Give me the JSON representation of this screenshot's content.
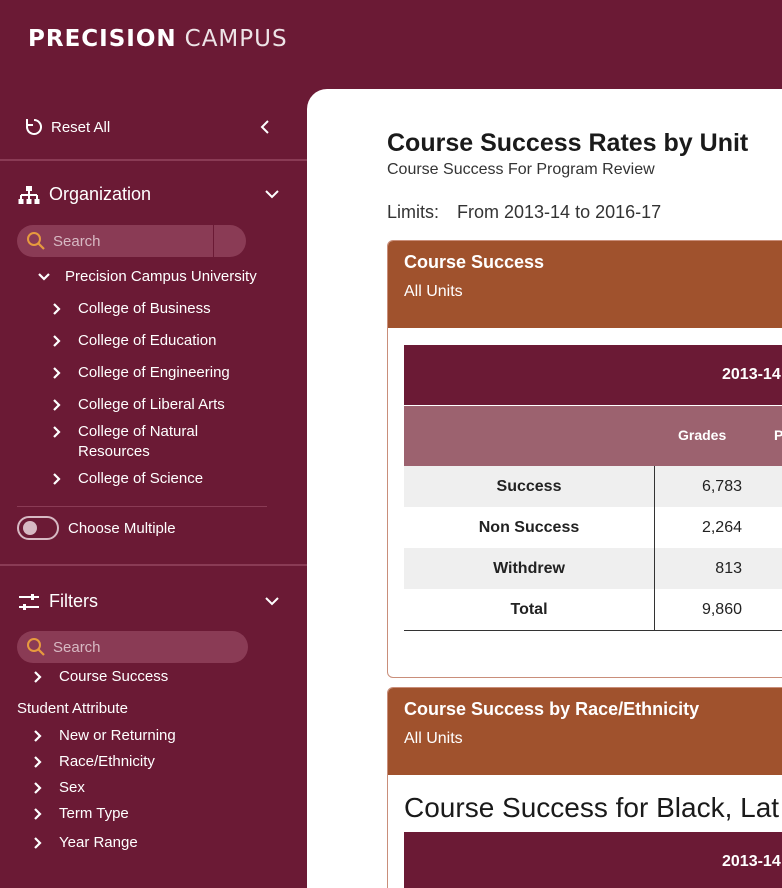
{
  "brand": {
    "bold": "PRECISION",
    "light": "CAMPUS"
  },
  "sidebar": {
    "reset_label": "Reset All",
    "organization": {
      "title": "Organization",
      "search_placeholder": "Search",
      "root": "Precision Campus University",
      "items": [
        "College of Business",
        "College of Education",
        "College of Engineering",
        "College of Liberal Arts",
        "College of Natural Resources",
        "College of Science"
      ],
      "choose_multiple": "Choose Multiple"
    },
    "filters": {
      "title": "Filters",
      "search_placeholder": "Search",
      "course_success": "Course Success",
      "group_label": "Student Attribute",
      "items": [
        "New or Returning",
        "Race/Ethnicity",
        "Sex",
        "Term Type",
        "Year Range"
      ]
    }
  },
  "main": {
    "title": "Course Success Rates by Unit",
    "subtitle": "Course Success For Program Review",
    "limits_label": "Limits:",
    "limits_value": "From 2013-14 to 2016-17",
    "panel1": {
      "title": "Course Success",
      "subtitle": "All Units",
      "year": "2013-14",
      "col_grades": "Grades",
      "col_pct_partial": "P",
      "rows": [
        {
          "label": "Success",
          "value": "6,783"
        },
        {
          "label": "Non Success",
          "value": "2,264"
        },
        {
          "label": "Withdrew",
          "value": "813"
        },
        {
          "label": "Total",
          "value": "9,860"
        }
      ]
    },
    "panel2": {
      "title": "Course Success by Race/Ethnicity",
      "subtitle": "All Units",
      "heading": "Course Success for Black, Lat",
      "year": "2013-14"
    }
  },
  "colors": {
    "maroon": "#6b1a35",
    "rust": "#a0522d",
    "accent_orange": "#e79a3e"
  }
}
